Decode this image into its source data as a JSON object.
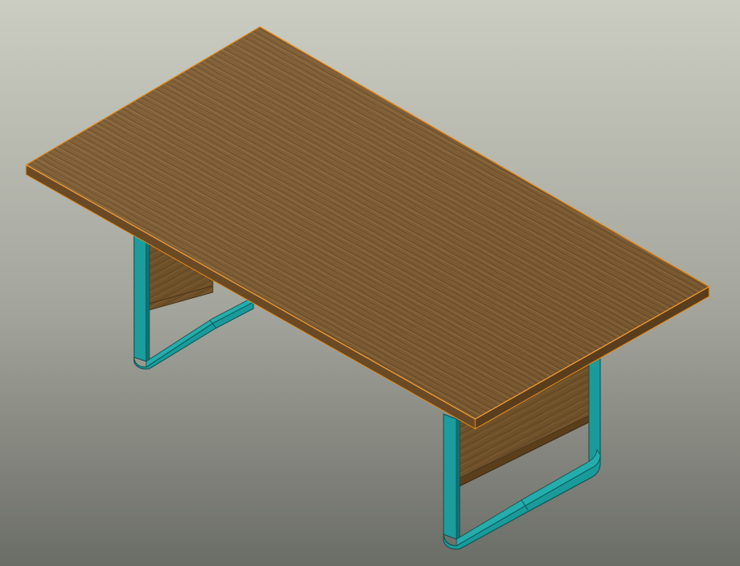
{
  "scene": {
    "description_visible_text": [],
    "object": "table-3d-model",
    "view": "isometric",
    "colors": {
      "background_top": "#c9cbbf",
      "background_bottom": "#6b6d67",
      "wood_light": "#8a6437",
      "wood_dark": "#6b4a26",
      "edge_highlight": "#e58a1a",
      "leg_frame": "#1a9a9a",
      "leg_frame_dark": "#117070",
      "leg_frame_edge": "#0d4f4f"
    }
  }
}
